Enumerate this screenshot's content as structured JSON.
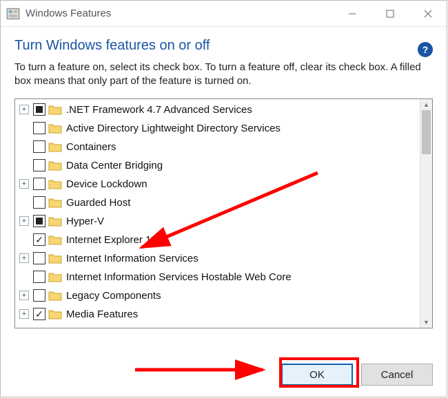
{
  "window": {
    "title": "Windows Features",
    "heading": "Turn Windows features on or off",
    "description": "To turn a feature on, select its check box. To turn a feature off, clear its check box. A filled box means that only part of the feature is turned on."
  },
  "features": [
    {
      "label": ".NET Framework 4.7 Advanced Services",
      "expandable": true,
      "state": "indeterminate"
    },
    {
      "label": "Active Directory Lightweight Directory Services",
      "expandable": false,
      "state": "unchecked"
    },
    {
      "label": "Containers",
      "expandable": false,
      "state": "unchecked"
    },
    {
      "label": "Data Center Bridging",
      "expandable": false,
      "state": "unchecked"
    },
    {
      "label": "Device Lockdown",
      "expandable": true,
      "state": "unchecked"
    },
    {
      "label": "Guarded Host",
      "expandable": false,
      "state": "unchecked"
    },
    {
      "label": "Hyper-V",
      "expandable": true,
      "state": "indeterminate"
    },
    {
      "label": "Internet Explorer 11",
      "expandable": false,
      "state": "checked"
    },
    {
      "label": "Internet Information Services",
      "expandable": true,
      "state": "unchecked"
    },
    {
      "label": "Internet Information Services Hostable Web Core",
      "expandable": false,
      "state": "unchecked"
    },
    {
      "label": "Legacy Components",
      "expandable": true,
      "state": "unchecked"
    },
    {
      "label": "Media Features",
      "expandable": true,
      "state": "checked"
    }
  ],
  "buttons": {
    "ok": "OK",
    "cancel": "Cancel"
  }
}
